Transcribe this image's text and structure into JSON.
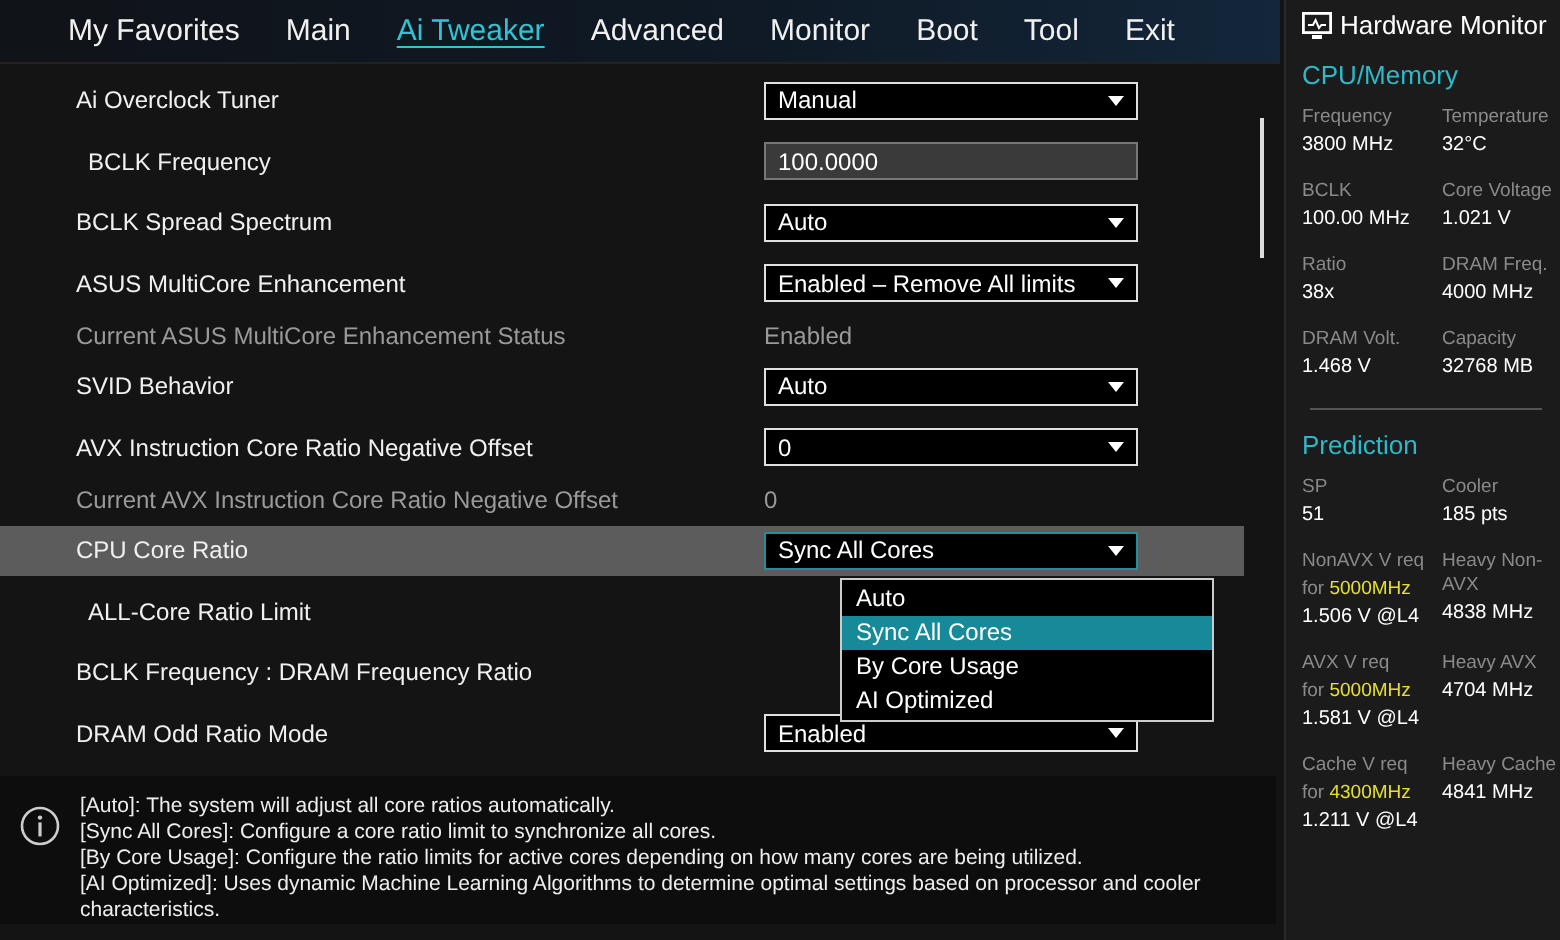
{
  "nav": {
    "tabs": [
      {
        "label": "My Favorites",
        "selected": false
      },
      {
        "label": "Main",
        "selected": false
      },
      {
        "label": "Ai Tweaker",
        "selected": true
      },
      {
        "label": "Advanced",
        "selected": false
      },
      {
        "label": "Monitor",
        "selected": false
      },
      {
        "label": "Boot",
        "selected": false
      },
      {
        "label": "Tool",
        "selected": false
      },
      {
        "label": "Exit",
        "selected": false
      }
    ]
  },
  "settings": [
    {
      "label": "Ai Overclock Tuner",
      "kind": "select",
      "value": "Manual",
      "indented": false,
      "selected": false,
      "expanded": false
    },
    {
      "label": "BCLK Frequency",
      "kind": "input",
      "value": "100.0000",
      "indented": true,
      "selected": false
    },
    {
      "label": "BCLK Spread Spectrum",
      "kind": "select",
      "value": "Auto",
      "indented": false,
      "selected": false,
      "expanded": false
    },
    {
      "label": "ASUS MultiCore Enhancement",
      "kind": "select",
      "value": "Enabled – Remove All limits",
      "indented": false,
      "selected": false,
      "expanded": false
    },
    {
      "label": "Current ASUS MultiCore Enhancement Status",
      "kind": "status",
      "value": "Enabled",
      "indented": false,
      "selected": false
    },
    {
      "label": "SVID Behavior",
      "kind": "select",
      "value": "Auto",
      "indented": false,
      "selected": false,
      "expanded": false
    },
    {
      "label": "AVX Instruction Core Ratio Negative Offset",
      "kind": "select",
      "value": "0",
      "indented": false,
      "selected": false,
      "expanded": false
    },
    {
      "label": "Current AVX Instruction Core Ratio Negative Offset",
      "kind": "status",
      "value": "0",
      "indented": false,
      "selected": false
    },
    {
      "label": "CPU Core Ratio",
      "kind": "select",
      "value": "Sync All Cores",
      "indented": false,
      "selected": true,
      "expanded": true,
      "options": [
        {
          "label": "Auto",
          "selected": false
        },
        {
          "label": "Sync All Cores",
          "selected": true
        },
        {
          "label": "By Core Usage",
          "selected": false
        },
        {
          "label": "AI Optimized",
          "selected": false
        }
      ]
    },
    {
      "label": "ALL-Core Ratio Limit",
      "kind": "label",
      "indented": true,
      "selected": false
    },
    {
      "label": "BCLK Frequency : DRAM Frequency Ratio",
      "kind": "label",
      "indented": false,
      "selected": false
    },
    {
      "label": "DRAM Odd Ratio Mode",
      "kind": "select",
      "value": "Enabled",
      "indented": false,
      "selected": false,
      "expanded": false
    }
  ],
  "help": {
    "lines": [
      "[Auto]: The system will adjust all core ratios automatically.",
      "[Sync All Cores]: Configure a core ratio limit to synchronize all cores.",
      "[By Core Usage]: Configure the ratio limits for active cores depending on how many cores are being utilized.",
      "[AI Optimized]: Uses dynamic Machine Learning Algorithms to determine optimal settings based on processor and cooler characteristics."
    ]
  },
  "hardware_monitor": {
    "title": "Hardware Monitor",
    "sections": [
      {
        "title": "CPU/Memory",
        "rows": [
          [
            {
              "label": "Frequency",
              "value": "3800 MHz"
            },
            {
              "label": "Temperature",
              "value": "32°C"
            }
          ],
          [
            {
              "label": "BCLK",
              "value": "100.00 MHz"
            },
            {
              "label": "Core Voltage",
              "value": "1.021 V"
            }
          ],
          [
            {
              "label": "Ratio",
              "value": "38x"
            },
            {
              "label": "DRAM Freq.",
              "value": "4000 MHz"
            }
          ],
          [
            {
              "label": "DRAM Volt.",
              "value": "1.468 V"
            },
            {
              "label": "Capacity",
              "value": "32768 MB"
            }
          ]
        ]
      },
      {
        "title": "Prediction",
        "rows": [
          [
            {
              "label": "SP",
              "value": "51"
            },
            {
              "label": "Cooler",
              "value": "185 pts"
            }
          ],
          [
            {
              "label": "NonAVX V req",
              "note": "for",
              "freq": "5000MHz",
              "value": "1.506 V @L4"
            },
            {
              "label": "Heavy Non-AVX",
              "value": "4838 MHz"
            }
          ],
          [
            {
              "label": "AVX V req",
              "note": "for",
              "freq": "5000MHz",
              "value": "1.581 V @L4"
            },
            {
              "label": "Heavy AVX",
              "value": "4704 MHz"
            }
          ],
          [
            {
              "label": "Cache V req",
              "note": "for",
              "freq": "4300MHz",
              "value": "1.211 V @L4"
            },
            {
              "label": "Heavy Cache",
              "value": "4841 MHz"
            }
          ]
        ]
      }
    ]
  }
}
